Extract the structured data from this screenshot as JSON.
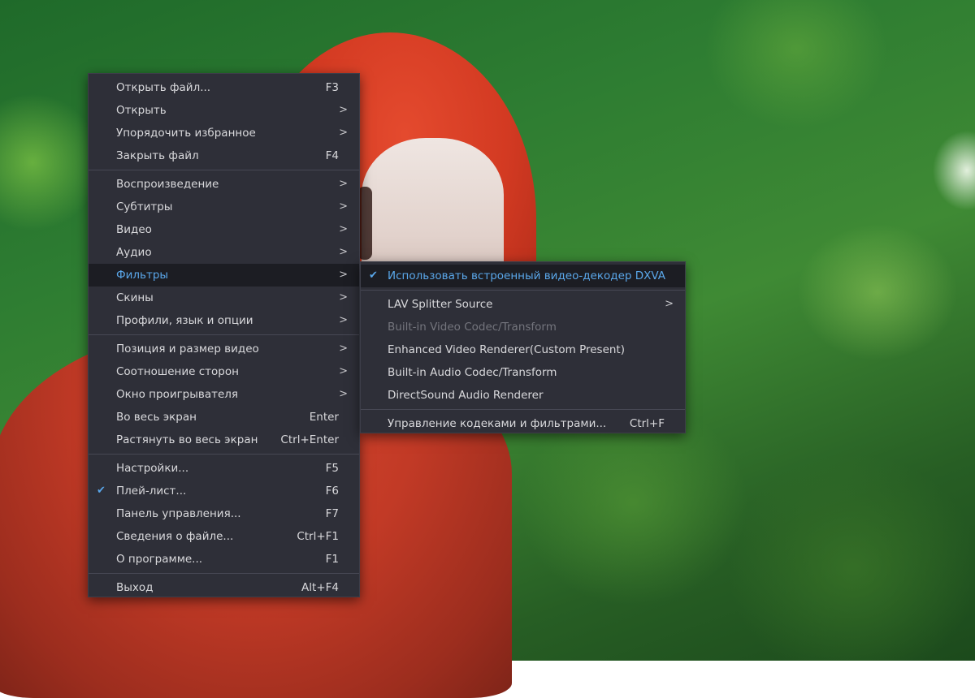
{
  "colors": {
    "menu_background": "#2e2f38",
    "active_background": "#1c1d23",
    "accent": "#5aa7ea",
    "text": "#d9d9dc",
    "disabled_text": "#74757d"
  },
  "main_menu": {
    "groups": [
      [
        {
          "label": "Открыть файл...",
          "shortcut": "F3"
        },
        {
          "label": "Открыть",
          "submenu": true
        },
        {
          "label": "Упорядочить избранное",
          "submenu": true
        },
        {
          "label": "Закрыть файл",
          "shortcut": "F4"
        }
      ],
      [
        {
          "label": "Воспроизведение",
          "submenu": true
        },
        {
          "label": "Субтитры",
          "submenu": true
        },
        {
          "label": "Видео",
          "submenu": true
        },
        {
          "label": "Аудио",
          "submenu": true
        },
        {
          "label": "Фильтры",
          "submenu": true,
          "active": true
        },
        {
          "label": "Скины",
          "submenu": true
        },
        {
          "label": "Профили, язык и опции",
          "submenu": true
        }
      ],
      [
        {
          "label": "Позиция и размер видео",
          "submenu": true
        },
        {
          "label": "Соотношение сторон",
          "submenu": true
        },
        {
          "label": "Окно проигрывателя",
          "submenu": true
        },
        {
          "label": "Во весь экран",
          "shortcut": "Enter"
        },
        {
          "label": "Растянуть во весь экран",
          "shortcut": "Ctrl+Enter"
        }
      ],
      [
        {
          "label": "Настройки...",
          "shortcut": "F5"
        },
        {
          "label": "Плей-лист...",
          "shortcut": "F6",
          "checked": true
        },
        {
          "label": "Панель управления...",
          "shortcut": "F7"
        },
        {
          "label": "Сведения о файле...",
          "shortcut": "Ctrl+F1"
        },
        {
          "label": "О программе...",
          "shortcut": "F1"
        }
      ],
      [
        {
          "label": "Выход",
          "shortcut": "Alt+F4"
        }
      ]
    ]
  },
  "filters_submenu": {
    "groups": [
      [
        {
          "label": "Использовать встроенный видео-декодер DXVA",
          "checked": true,
          "active": true
        }
      ],
      [
        {
          "label": "LAV Splitter Source",
          "submenu": true
        },
        {
          "label": "Built-in Video Codec/Transform",
          "disabled": true
        },
        {
          "label": "Enhanced Video Renderer(Custom Present)"
        },
        {
          "label": "Built-in Audio Codec/Transform"
        },
        {
          "label": "DirectSound Audio Renderer"
        }
      ],
      [
        {
          "label": "Управление кодеками и фильтрами...",
          "shortcut": "Ctrl+F"
        }
      ]
    ]
  },
  "icons": {
    "submenu_arrow": ">",
    "check_mark": "✔"
  }
}
